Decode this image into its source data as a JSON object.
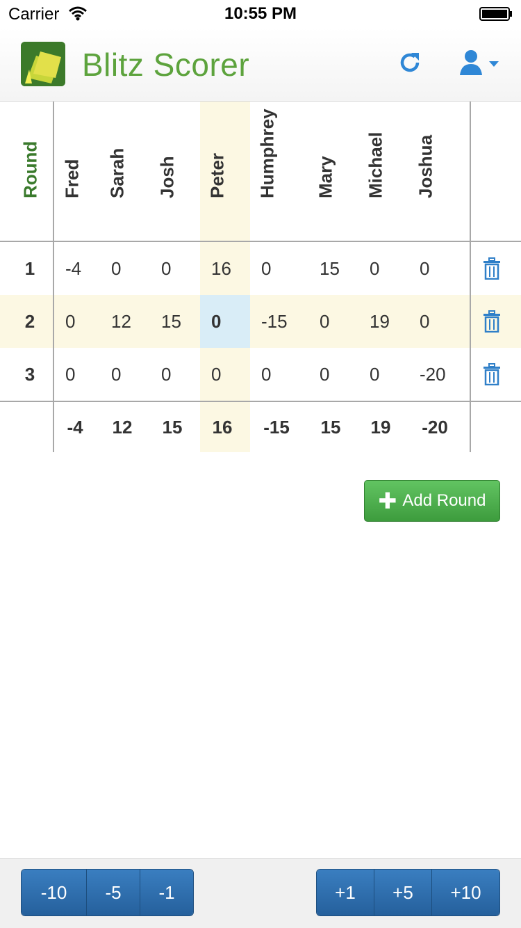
{
  "status_bar": {
    "carrier": "Carrier",
    "time": "10:55 PM"
  },
  "navbar": {
    "title": "Blitz Scorer",
    "refresh_icon": "refresh-icon",
    "user_icon": "user-icon"
  },
  "table": {
    "round_header": "Round",
    "players": [
      "Fred",
      "Sarah",
      "Josh",
      "Peter",
      "Humphrey",
      "Mary",
      "Michael",
      "Joshua"
    ],
    "rounds": [
      {
        "number": "1",
        "scores": [
          "-4",
          "0",
          "0",
          "16",
          "0",
          "15",
          "0",
          "0"
        ]
      },
      {
        "number": "2",
        "scores": [
          "0",
          "12",
          "15",
          "0",
          "-15",
          "0",
          "19",
          "0"
        ]
      },
      {
        "number": "3",
        "scores": [
          "0",
          "0",
          "0",
          "0",
          "0",
          "0",
          "0",
          "-20"
        ]
      }
    ],
    "totals": [
      "-4",
      "12",
      "15",
      "16",
      "-15",
      "15",
      "19",
      "-20"
    ],
    "highlighted_player": "Peter",
    "selected_round": "2"
  },
  "add_round": {
    "label": "Add Round"
  },
  "steppers": {
    "minus": [
      "-10",
      "-5",
      "-1"
    ],
    "plus": [
      "+1",
      "+5",
      "+10"
    ]
  },
  "colors": {
    "accent": "#5da33d",
    "primary": "#2a6fb0",
    "highlight": "#fcf8e3",
    "selected": "#d9edf7"
  }
}
